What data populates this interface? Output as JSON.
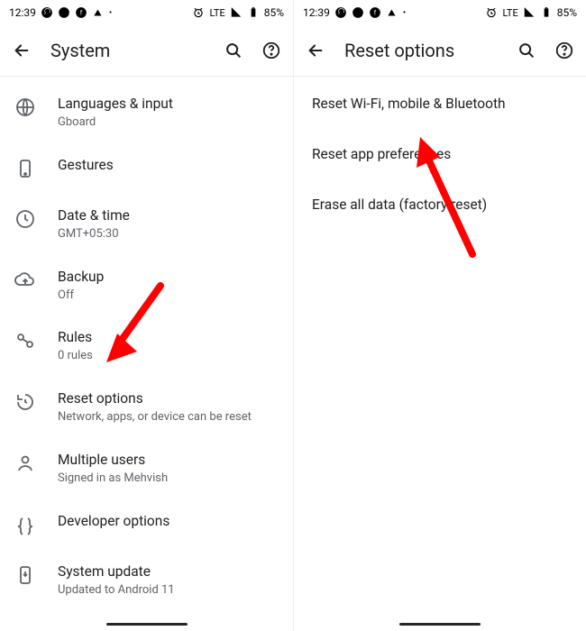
{
  "statusbar": {
    "time": "12:39",
    "lte": "LTE",
    "battery": "85%"
  },
  "screens": {
    "left": {
      "title": "System",
      "items": [
        {
          "title": "Languages & input",
          "subtitle": "Gboard"
        },
        {
          "title": "Gestures",
          "subtitle": ""
        },
        {
          "title": "Date & time",
          "subtitle": "GMT+05:30"
        },
        {
          "title": "Backup",
          "subtitle": "Off"
        },
        {
          "title": "Rules",
          "subtitle": "0 rules"
        },
        {
          "title": "Reset options",
          "subtitle": "Network, apps, or device can be reset"
        },
        {
          "title": "Multiple users",
          "subtitle": "Signed in as Mehvish"
        },
        {
          "title": "Developer options",
          "subtitle": ""
        },
        {
          "title": "System update",
          "subtitle": "Updated to Android 11"
        }
      ]
    },
    "right": {
      "title": "Reset options",
      "items": [
        {
          "title": "Reset Wi-Fi, mobile & Bluetooth"
        },
        {
          "title": "Reset app preferences"
        },
        {
          "title": "Erase all data (factory reset)"
        }
      ]
    }
  }
}
